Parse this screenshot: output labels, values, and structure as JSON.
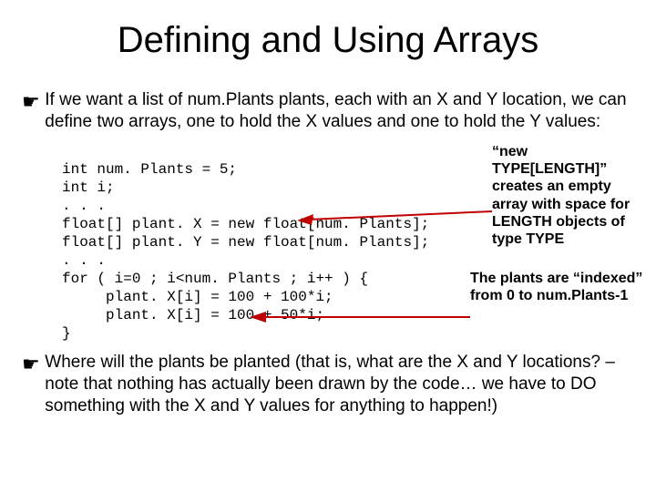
{
  "title": "Defining and Using Arrays",
  "bullet_icon": "☛",
  "para1": "If we want a list of num.Plants plants, each with an X and Y location, we can define two arrays, one to hold the X values and one to hold the Y values:",
  "code": "int num. Plants = 5;\nint i;\n. . .\nfloat[] plant. X = new float[num. Plants];\nfloat[] plant. Y = new float[num. Plants];\n. . .\nfor ( i=0 ; i<num. Plants ; i++ ) {\n     plant. X[i] = 100 + 100*i;\n     plant. X[i] = 100 + 50*i;\n}",
  "annot1": "“new TYPE[LENGTH]” creates an empty array with space for LENGTH objects of type TYPE",
  "annot2": "The plants are “indexed” from 0 to num.Plants-1",
  "para2": "Where will the plants be planted (that is, what are the X and Y locations? – note that nothing has actually been drawn by the code… we have to DO something with the X and Y values for anything to happen!)"
}
